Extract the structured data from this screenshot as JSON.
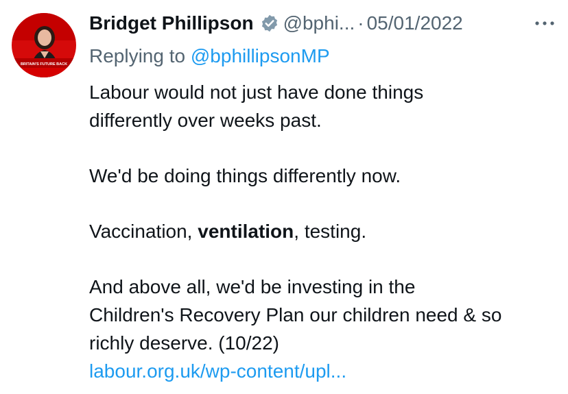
{
  "tweet": {
    "author_name": "Bridget Phillipson",
    "handle": "@bphi...",
    "separator": "·",
    "date": "05/01/2022",
    "reply_prefix": "Replying to",
    "reply_to": "@bphillipsonMP",
    "paragraphs": {
      "p1_line1": "Labour would not just have done things",
      "p1_line2": "differently over weeks past.",
      "p2": "We'd be doing things differently now.",
      "p3_pre": "Vaccination, ",
      "p3_bold": "ventilation",
      "p3_post": ", testing.",
      "p4_line1": "And above all, we'd be investing in the",
      "p4_line2": "Children's Recovery Plan our children need & so",
      "p4_line3": "richly deserve. (10/22)"
    },
    "link_text": "labour.org.uk/wp-content/upl...",
    "avatar_banner_text": "BRITAIN'S FUTURE BACK"
  },
  "colors": {
    "text": "#0f1419",
    "secondary": "#536471",
    "link": "#1d9bf0",
    "avatar_red": "#d50000"
  },
  "icons": {
    "verified": "verified-badge-icon",
    "more": "more-options-icon"
  }
}
